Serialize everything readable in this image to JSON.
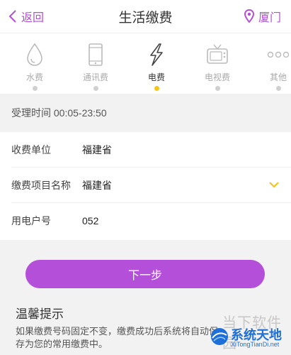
{
  "header": {
    "back_label": "返回",
    "title": "生活缴费",
    "city": "厦门"
  },
  "tabs": [
    {
      "label": "水费",
      "icon": "water-drop-icon",
      "active": false
    },
    {
      "label": "通讯费",
      "icon": "phone-icon",
      "active": false
    },
    {
      "label": "电费",
      "icon": "lightning-icon",
      "active": true
    },
    {
      "label": "电视费",
      "icon": "tv-icon",
      "active": false
    },
    {
      "label": "其他",
      "icon": "more-icon",
      "active": false
    }
  ],
  "service_hours": "受理时间 00:05-23:50",
  "form": {
    "payee_label": "收费单位",
    "payee_value": "福建省",
    "item_label": "缴费项目名称",
    "item_value": "福建省",
    "account_label": "用电户号",
    "account_value": "052"
  },
  "next_button": "下一步",
  "tips": {
    "title": "温馨提示",
    "text": "如果缴费号码固定不变，缴费成功后系统将自动保存为您的常用缴费中。"
  },
  "watermark": {
    "site_cn": "当下软件园",
    "brand": "系统天地",
    "url": "XiTongTianDi.net"
  },
  "colors": {
    "accent": "#b34fd8",
    "active_dot": "#f5c518",
    "chevron": "#f5c518"
  }
}
